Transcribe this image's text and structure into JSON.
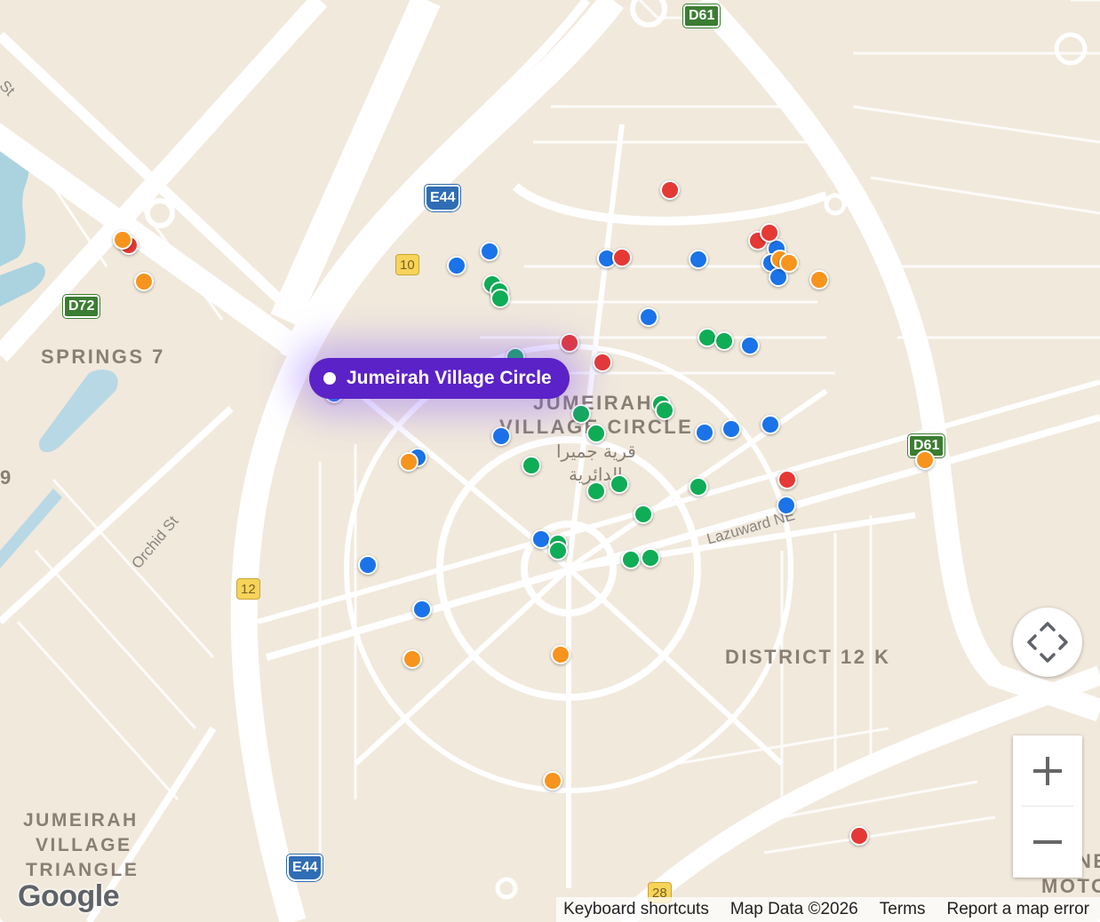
{
  "map": {
    "area_labels": {
      "springs": "SPRINGS 7",
      "jvc_line1": "JUMEIRAH",
      "jvc_line2": "VILLAGE CIRCLE",
      "district": "DISTRICT 12 K",
      "jvt_line1": "JUMEIRAH",
      "jvt_line2": "VILLAGE",
      "jvt_line3": "TRIANGLE",
      "edge_right1": "NE",
      "edge_right2": "MOTO",
      "edge_left": "9"
    },
    "arabic_labels": {
      "line1": "قرية جميرا",
      "line2": "الدائرية"
    },
    "street_labels": {
      "orchid": "Orchid St",
      "lazuward": "Lazuward NE",
      "top_left_st": "St"
    },
    "road_shields": {
      "d61_top": "D61",
      "d61_right": "D61",
      "d72": "D72",
      "e44_top": "E44",
      "e44_bottom": "E44",
      "r10": "10",
      "r12": "12",
      "r28": "28"
    },
    "callout": {
      "label": "Jumeirah Village Circle"
    },
    "marker_colors": {
      "red": "#e53935",
      "blue": "#1a73e8",
      "green": "#0fad55",
      "orange": "#f7941d"
    },
    "callout_color": "#5b22c7"
  },
  "controls": {
    "pan_icon": "pan-arrows-icon",
    "zoom_in_icon": "plus-icon",
    "zoom_out_icon": "minus-icon"
  },
  "branding": {
    "logo": "Google"
  },
  "footer": {
    "keyboard_shortcuts": "Keyboard shortcuts",
    "map_data": "Map Data ©2026",
    "terms": "Terms",
    "report": "Report a map error"
  }
}
